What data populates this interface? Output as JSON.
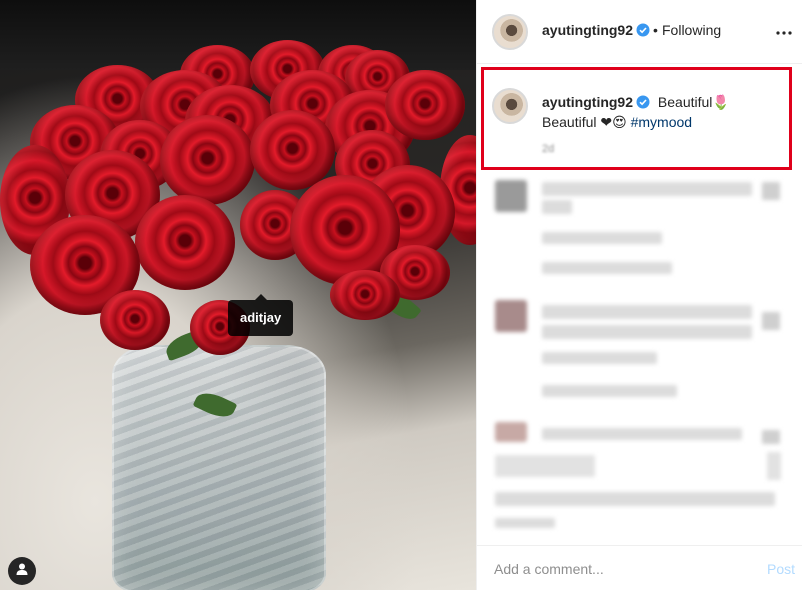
{
  "photo": {
    "tagged_user": "aditjay",
    "user_tag_icon": "user-icon"
  },
  "header": {
    "username": "ayutingting92",
    "separator": "•",
    "follow_status": "Following",
    "more_icon": "more-horizontal-icon",
    "verified_icon": "verified-badge-icon"
  },
  "caption": {
    "username": "ayutingting92",
    "text": "Beautiful🌷Beautiful ❤😍",
    "hashtag": "#mymood",
    "time_ago": "2d"
  },
  "comment_box": {
    "placeholder": "Add a comment...",
    "post_label": "Post"
  },
  "colors": {
    "highlight_border": "#e0001b",
    "hashtag": "#00376b",
    "post_disabled": "#b3dbff",
    "verified": "#3897f0"
  }
}
